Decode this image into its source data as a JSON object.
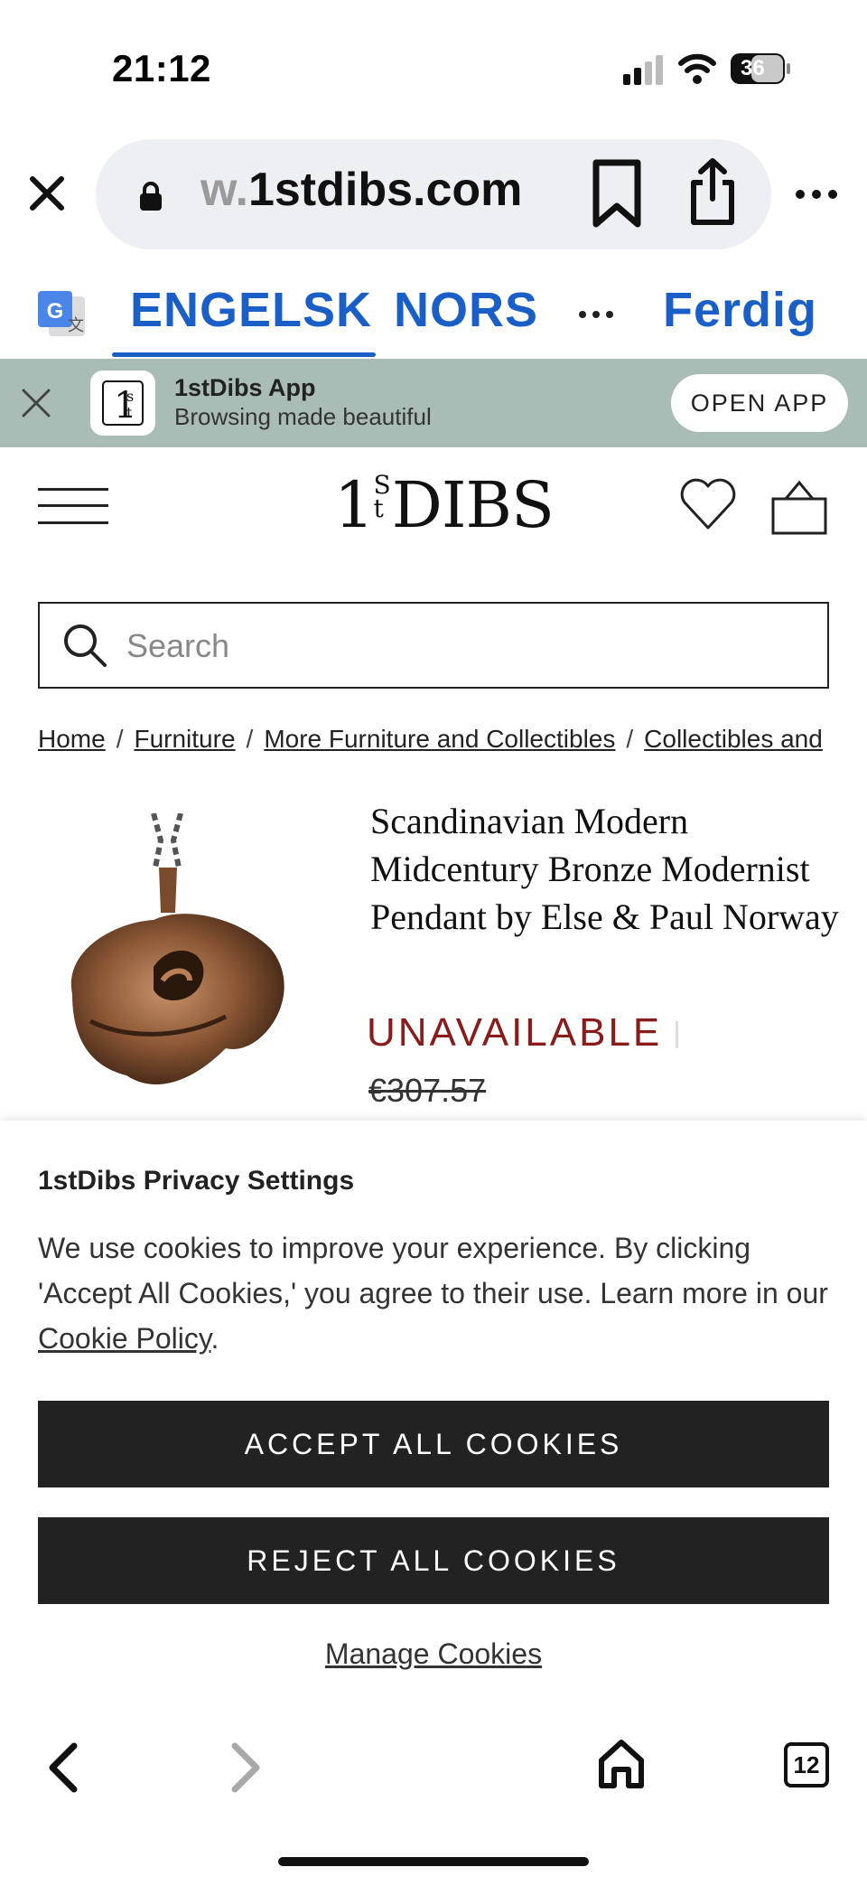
{
  "status_bar": {
    "time": "21:12",
    "battery_percent": "36"
  },
  "browser": {
    "url_faded": "w.",
    "url_main": "1stdibs.com",
    "icons": [
      "close-icon",
      "lock-icon",
      "bookmark-icon",
      "share-icon",
      "more-icon"
    ]
  },
  "translate_bar": {
    "tab_source": "ENGELSK",
    "tab_target": "NORS",
    "done_label": "Ferdig"
  },
  "app_banner": {
    "title": "1stDibs App",
    "subtitle": "Browsing made beautiful",
    "open_label": "OPEN APP"
  },
  "header": {
    "logo_main_1": "1",
    "logo_sup": "S",
    "logo_sub": "t",
    "logo_main_2": "DIBS"
  },
  "search": {
    "placeholder": "Search"
  },
  "breadcrumb": {
    "items": [
      "Home",
      "Furniture",
      "More Furniture and Collectibles",
      "Collectibles and"
    ]
  },
  "product": {
    "title": "Scandinavian Modern Midcentury Bronze Modernist Pendant by Else & Paul Norway",
    "status": "UNAVAILABLE",
    "old_price": "€307.57"
  },
  "cookie_banner": {
    "title": "1stDibs Privacy Settings",
    "body": "We use cookies to improve your experience. By clicking 'Accept All Cookies,' you agree to their use. Learn more in our ",
    "policy_link": "Cookie Policy",
    "body_end": ".",
    "accept_label": "ACCEPT ALL COOKIES",
    "reject_label": "REJECT ALL COOKIES",
    "manage_label": "Manage Cookies"
  },
  "toolbar": {
    "tab_count": "12"
  },
  "colors": {
    "translate_blue": "#1a5fc8",
    "banner_bg": "#a9bdb6",
    "unavailable_red": "#8b1a1a",
    "button_dark": "#222222"
  }
}
